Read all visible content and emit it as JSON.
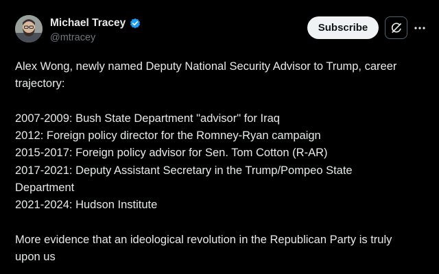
{
  "author": {
    "display_name": "Michael Tracey",
    "handle": "@mtracey",
    "avatar_icon": "bearded-man-avatar",
    "verified_icon": "verified-badge-icon",
    "verified_color": "#1d9bf0"
  },
  "actions": {
    "subscribe_label": "Subscribe",
    "grok_icon": "grok-icon",
    "more_icon": "more-dots-icon"
  },
  "tweet": {
    "lines": [
      "Alex Wong, newly named Deputy National Security Advisor to Trump, career",
      "trajectory:",
      "",
      "2007-2009: Bush State Department \"advisor\" for Iraq",
      "2012: Foreign policy director for the Romney-Ryan campaign",
      "2015-2017: Foreign policy advisor for Sen. Tom Cotton (R-AR)",
      "2017-2021: Deputy Assistant Secretary in the Trump/Pompeo State",
      "Department",
      "2021-2024: Hudson Institute",
      "",
      "More evidence that an ideological revolution in the Republican Party is truly",
      "upon us"
    ]
  },
  "colors": {
    "background": "#000000",
    "text": "#e7e9ea",
    "secondary_text": "#71767b",
    "button_bg": "#eff3f4",
    "button_text": "#0f1419"
  }
}
